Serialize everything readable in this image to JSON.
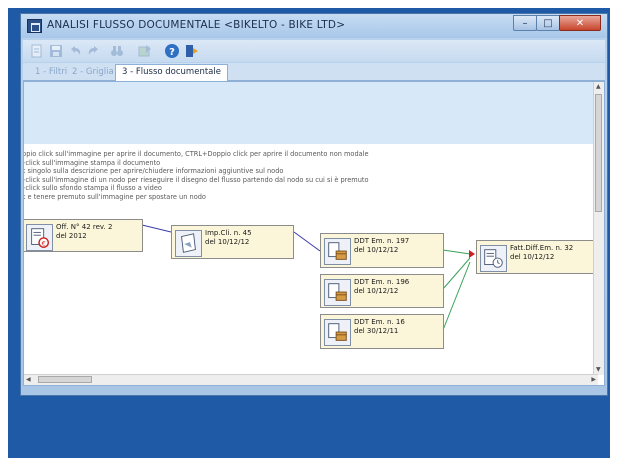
{
  "window": {
    "title": "ANALISI FLUSSO DOCUMENTALE <BIKELTO - BIKE LTD>"
  },
  "tabs": [
    {
      "label": "1 - Filtri",
      "active": false
    },
    {
      "label": "2 - Griglia",
      "active": false
    },
    {
      "label": "3 - Flusso documentale",
      "active": true
    }
  ],
  "toolbar": {
    "icons": [
      "new-icon",
      "save-icon",
      "undo-icon",
      "redo-icon",
      "binoculars-icon",
      "export-icon",
      "help-icon",
      "exit-icon"
    ]
  },
  "help_lines": [
    "oppio click sull'immagine per aprire il documento, CTRL+Doppio click per aprire il documento non modale",
    "l+click sull'immagine stampa il documento",
    "ck singolo sulla descrizione per aprire/chiudere informazioni aggiuntive sul nodo",
    "l+click sull'immagine di un nodo per rieseguire il disegno del flusso partendo dal nodo su cui si è premuto",
    "l+click sullo sfondo stampa il flusso a video",
    "ck e tenere premuto sull'immagine per spostare un nodo"
  ],
  "nodes": [
    {
      "line1": "Off. N° 42 rev. 2",
      "line2": "del 2012"
    },
    {
      "line1": "Imp.Cli. n. 45",
      "line2": "del 10/12/12"
    },
    {
      "line1": "DDT Em. n. 197",
      "line2": "del 10/12/12"
    },
    {
      "line1": "DDT Em. n. 196",
      "line2": "del 10/12/12"
    },
    {
      "line1": "DDT Em. n. 16",
      "line2": "del 30/12/11"
    },
    {
      "line1": "Fatt.Diff.Em. n. 32",
      "line2": "del 10/12/12"
    }
  ],
  "colors": {
    "frame": "#1e5aa6",
    "node_bg": "#fbf6d9",
    "link_blue": "#3b3ba8",
    "link_green": "#3aa05a",
    "marker_red": "#cc1f1f"
  }
}
